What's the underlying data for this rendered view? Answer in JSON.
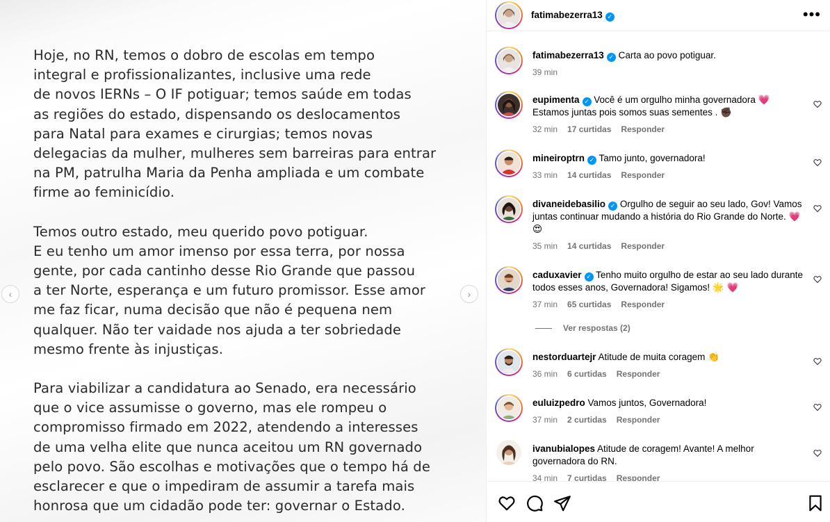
{
  "post": {
    "paragraphs": [
      "    Hoje, no RN, temos o dobro de escolas em tempo\nintegral e profissionalizantes, inclusive uma rede\nde novos IERNs – O IF potiguar; temos saúde em todas\nas regiões do estado, dispensando os deslocamentos\npara Natal para exames e cirurgias; temos novas\ndelegacias da mulher, mulheres sem barreiras para entrar\nna PM, patrulha Maria da Penha ampliada e um combate\nfirme ao feminicídio.",
      "    Temos outro estado, meu querido povo potiguar.\nE eu tenho um amor imenso por essa terra, por nossa\ngente, por cada cantinho desse Rio Grande que passou\na ter Norte, esperança e um futuro promissor. Esse amor\nme faz ficar, numa decisão que não é pequena nem\nqualquer. Não ter vaidade nos ajuda a ter sobriedade\nmesmo frente às injustiças.",
      "    Para viabilizar a candidatura ao Senado, era necessário\nque o vice assumisse o governo, mas ele rompeu o\ncompromisso firmado em 2022, atendendo a interesses\nde uma velha elite que nunca aceitou um RN governado\npelo povo. São escolhas e motivações que o tempo há de\nesclarecer e que o impediram de assumir a tarefa mais\nhonrosa que um cidadão pode ter: governar o Estado."
    ],
    "prev_icon": "chevron-left-icon",
    "next_icon": "chevron-right-icon"
  },
  "header": {
    "username": "fatimabezerra13",
    "more_icon": "more-horizontal-icon",
    "more_label": "•••"
  },
  "caption": {
    "username": "fatimabezerra13",
    "text": "Carta ao povo potiguar.",
    "time": "39 min"
  },
  "comments": [
    {
      "username": "eupimenta",
      "verified": true,
      "text": "Você é um orgulho minha governadora 💗\nEstamos juntas pois somos suas sementes . ✊🏿",
      "time": "32 min",
      "likes": "17 curtidas",
      "reply": "Responder"
    },
    {
      "username": "mineiroptrn",
      "verified": true,
      "text": "Tamo junto, governadora!",
      "time": "33 min",
      "likes": "14 curtidas",
      "reply": "Responder"
    },
    {
      "username": "divaneidebasilio",
      "verified": true,
      "text": "Orgulho de seguir ao seu lado, Gov! Vamos juntas continuar mudando a história do Rio Grande do Norte. 💗😍",
      "time": "35 min",
      "likes": "14 curtidas",
      "reply": "Responder"
    },
    {
      "username": "caduxavier",
      "verified": true,
      "text": "Tenho muito orgulho de estar ao seu lado durante todos esses anos, Governadora! Sigamos! 🌟 💗",
      "time": "37 min",
      "likes": "65 curtidas",
      "reply": "Responder"
    },
    {
      "username": "nestorduartejr",
      "verified": false,
      "text": "Atitude de muita coragem 👏",
      "time": "36 min",
      "likes": "6 curtidas",
      "reply": "Responder"
    },
    {
      "username": "euluizpedro",
      "verified": false,
      "text": "Vamos juntos, Governadora!",
      "time": "37 min",
      "likes": "2 curtidas",
      "reply": "Responder"
    },
    {
      "username": "ivanubialopes",
      "verified": false,
      "text": "Atitude de coragem! Avante! A melhor governadora do RN.",
      "time": "34 min",
      "likes": "7 curtidas",
      "reply": "Responder"
    }
  ],
  "view_replies": "Ver respostas (2)",
  "actions": {
    "like_icon": "heart-icon",
    "comment_icon": "comment-icon",
    "share_icon": "send-icon",
    "save_icon": "bookmark-icon"
  },
  "colors": {
    "verified": "#0095f6",
    "meta": "#737373",
    "border": "#efefef"
  }
}
